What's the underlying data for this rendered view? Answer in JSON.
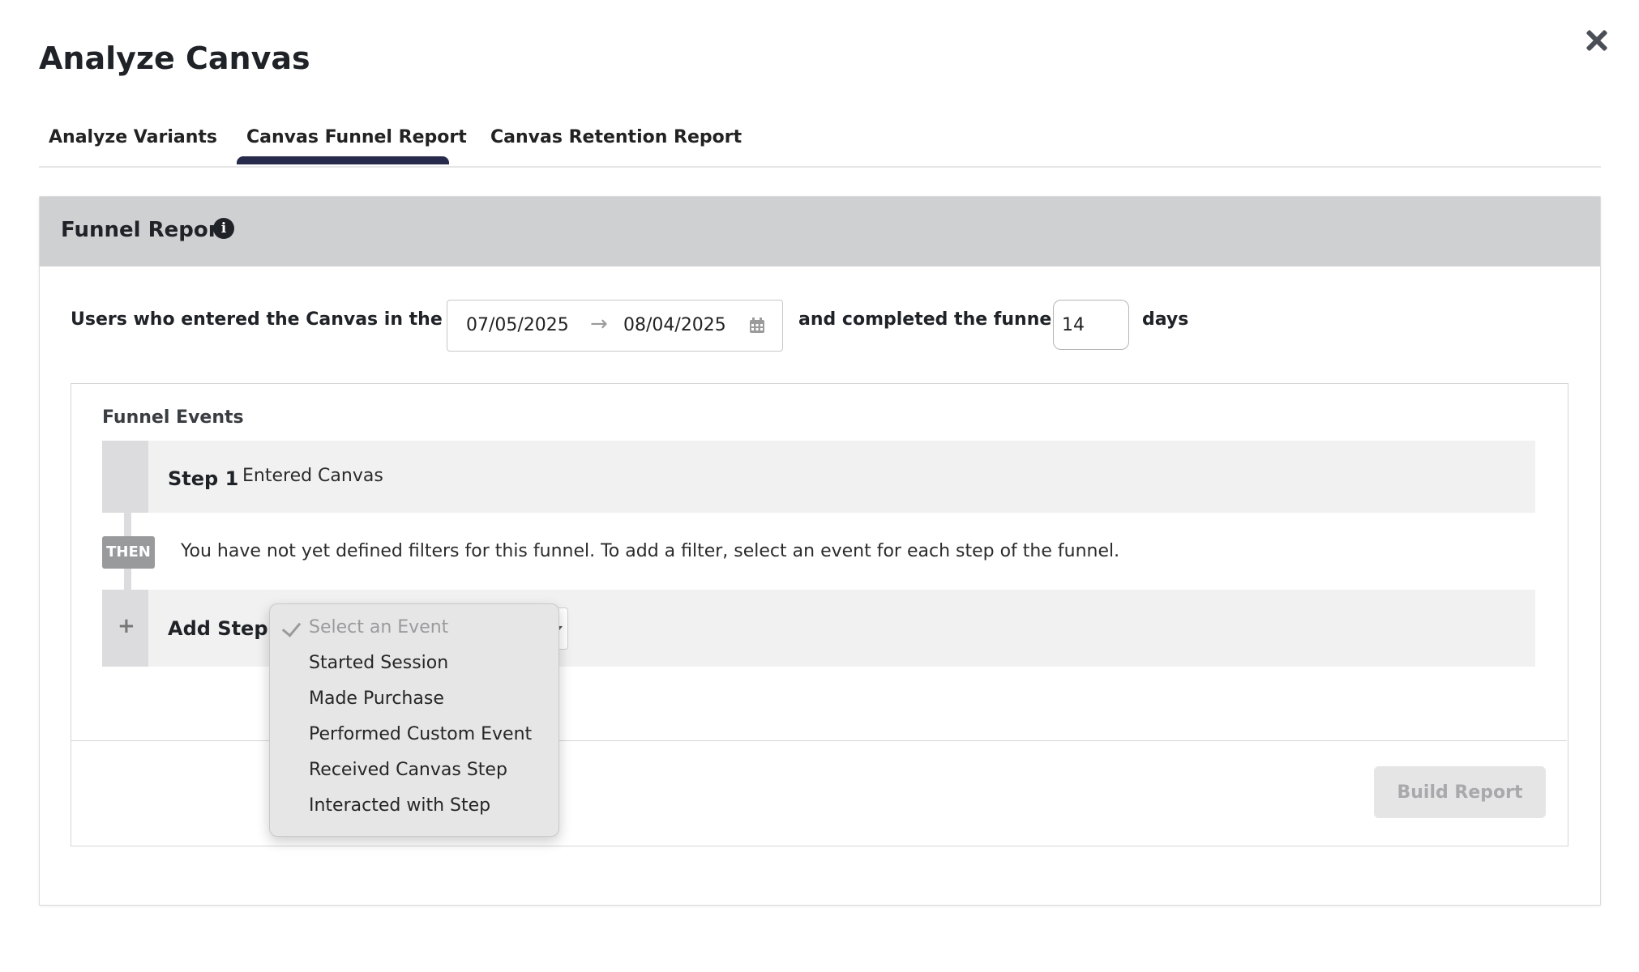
{
  "header": {
    "title": "Analyze Canvas",
    "close_icon": "close-icon"
  },
  "tabs": [
    {
      "label": "Analyze Variants",
      "active": false
    },
    {
      "label": "Canvas Funnel Report",
      "active": true
    },
    {
      "label": "Canvas Retention Report",
      "active": false
    }
  ],
  "report": {
    "title": "Funnel Report",
    "info_icon": "info-icon",
    "info_glyph": "i",
    "prefix_label": "Users who entered the Canvas in the past",
    "date_start": "07/05/2025",
    "date_arrow": "→",
    "date_end": "08/04/2025",
    "calendar_icon": "calendar-icon",
    "completed_label": "and completed the funnel in",
    "days_value": "14",
    "days_label": "days"
  },
  "funnel": {
    "title": "Funnel Events",
    "step1_label": "Step 1",
    "step1_event": "Entered Canvas",
    "then_badge": "THEN",
    "then_text": "You have not yet defined filters for this funnel. To add a filter, select an event for each step of the funnel.",
    "add_step_plus": "+",
    "add_step_label": "Add Step",
    "build_button": "Build Report"
  },
  "dropdown": {
    "options": [
      {
        "label": "Select an Event",
        "selected": true
      },
      {
        "label": "Started Session",
        "selected": false
      },
      {
        "label": "Made Purchase",
        "selected": false
      },
      {
        "label": "Performed Custom Event",
        "selected": false
      },
      {
        "label": "Received Canvas Step",
        "selected": false
      },
      {
        "label": "Interacted with Step",
        "selected": false
      }
    ]
  },
  "colors": {
    "tab_indicator": "#272a4a",
    "card_header_bg": "#cfd0d2",
    "then_badge_bg": "#999a9c",
    "build_button_bg": "#e5e5e6"
  }
}
